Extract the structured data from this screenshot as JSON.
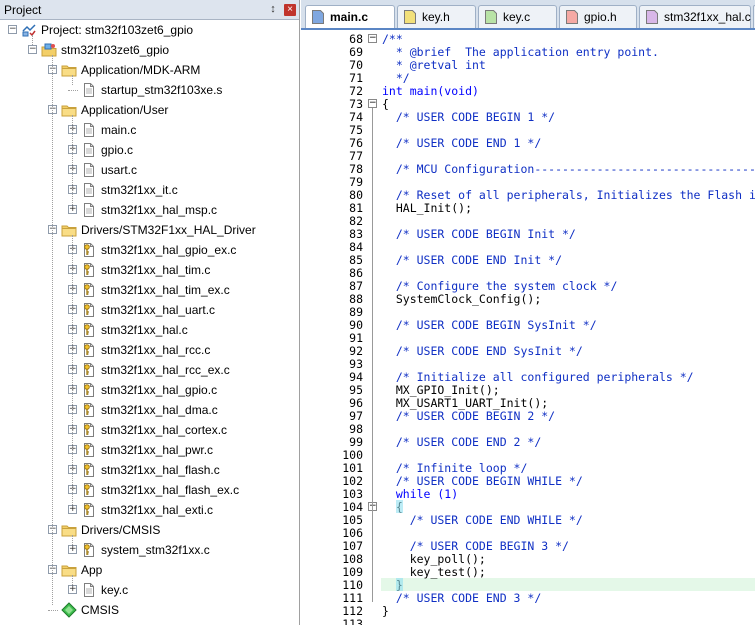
{
  "panel": {
    "title": "Project",
    "pin_glyph": "↕",
    "close_glyph": "×"
  },
  "tree": [
    {
      "label": "Project: stm32f103zet6_gpio",
      "level": 0,
      "icon": "project-icon",
      "expander": "−"
    },
    {
      "label": "stm32f103zet6_gpio",
      "level": 1,
      "icon": "target-icon",
      "expander": "−"
    },
    {
      "label": "Application/MDK-ARM",
      "level": 2,
      "icon": "folder-icon",
      "expander": "−"
    },
    {
      "label": "startup_stm32f103xe.s",
      "level": 3,
      "icon": "file-icon",
      "expander": ""
    },
    {
      "label": "Application/User",
      "level": 2,
      "icon": "folder-icon",
      "expander": "−"
    },
    {
      "label": "main.c",
      "level": 3,
      "icon": "file-icon",
      "expander": "+"
    },
    {
      "label": "gpio.c",
      "level": 3,
      "icon": "file-icon",
      "expander": "+"
    },
    {
      "label": "usart.c",
      "level": 3,
      "icon": "file-icon",
      "expander": "+"
    },
    {
      "label": "stm32f1xx_it.c",
      "level": 3,
      "icon": "file-icon",
      "expander": "+"
    },
    {
      "label": "stm32f1xx_hal_msp.c",
      "level": 3,
      "icon": "file-icon",
      "expander": "+"
    },
    {
      "label": "Drivers/STM32F1xx_HAL_Driver",
      "level": 2,
      "icon": "folder-icon",
      "expander": "−"
    },
    {
      "label": "stm32f1xx_hal_gpio_ex.c",
      "level": 3,
      "icon": "key-file-icon",
      "expander": "+"
    },
    {
      "label": "stm32f1xx_hal_tim.c",
      "level": 3,
      "icon": "key-file-icon",
      "expander": "+"
    },
    {
      "label": "stm32f1xx_hal_tim_ex.c",
      "level": 3,
      "icon": "key-file-icon",
      "expander": "+"
    },
    {
      "label": "stm32f1xx_hal_uart.c",
      "level": 3,
      "icon": "key-file-icon",
      "expander": "+"
    },
    {
      "label": "stm32f1xx_hal.c",
      "level": 3,
      "icon": "key-file-icon",
      "expander": "+"
    },
    {
      "label": "stm32f1xx_hal_rcc.c",
      "level": 3,
      "icon": "key-file-icon",
      "expander": "+"
    },
    {
      "label": "stm32f1xx_hal_rcc_ex.c",
      "level": 3,
      "icon": "key-file-icon",
      "expander": "+"
    },
    {
      "label": "stm32f1xx_hal_gpio.c",
      "level": 3,
      "icon": "key-file-icon",
      "expander": "+"
    },
    {
      "label": "stm32f1xx_hal_dma.c",
      "level": 3,
      "icon": "key-file-icon",
      "expander": "+"
    },
    {
      "label": "stm32f1xx_hal_cortex.c",
      "level": 3,
      "icon": "key-file-icon",
      "expander": "+"
    },
    {
      "label": "stm32f1xx_hal_pwr.c",
      "level": 3,
      "icon": "key-file-icon",
      "expander": "+"
    },
    {
      "label": "stm32f1xx_hal_flash.c",
      "level": 3,
      "icon": "key-file-icon",
      "expander": "+"
    },
    {
      "label": "stm32f1xx_hal_flash_ex.c",
      "level": 3,
      "icon": "key-file-icon",
      "expander": "+"
    },
    {
      "label": "stm32f1xx_hal_exti.c",
      "level": 3,
      "icon": "key-file-icon",
      "expander": "+"
    },
    {
      "label": "Drivers/CMSIS",
      "level": 2,
      "icon": "folder-icon",
      "expander": "−"
    },
    {
      "label": "system_stm32f1xx.c",
      "level": 3,
      "icon": "key-file-icon",
      "expander": "+"
    },
    {
      "label": "App",
      "level": 2,
      "icon": "folder-icon",
      "expander": "−"
    },
    {
      "label": "key.c",
      "level": 3,
      "icon": "file-icon",
      "expander": "+"
    },
    {
      "label": "CMSIS",
      "level": 2,
      "icon": "cmsis-icon",
      "expander": ""
    }
  ],
  "tabs": [
    {
      "label": "main.c",
      "active": true,
      "color": "#7fa7e0"
    },
    {
      "label": "key.h",
      "active": false,
      "color": "#f2e07a"
    },
    {
      "label": "key.c",
      "active": false,
      "color": "#b9e3a7"
    },
    {
      "label": "gpio.h",
      "active": false,
      "color": "#f5a9a4"
    },
    {
      "label": "stm32f1xx_hal.c",
      "active": false,
      "color": "#d8b7e8"
    },
    {
      "label": "",
      "active": false,
      "color": "#b9e3a7"
    }
  ],
  "code": [
    {
      "n": "68",
      "t": "/**",
      "c": "cmt",
      "fold": "−"
    },
    {
      "n": "69",
      "t": "  * @brief  The application entry point.",
      "c": "cmt"
    },
    {
      "n": "70",
      "t": "  * @retval int",
      "c": "cmt"
    },
    {
      "n": "71",
      "t": "  */",
      "c": "cmt"
    },
    {
      "n": "72",
      "t": "int main(void)",
      "c": "kwline"
    },
    {
      "n": "73",
      "t": "{",
      "c": "tx",
      "fold": "−"
    },
    {
      "n": "74",
      "t": "  /* USER CODE BEGIN 1 */",
      "c": "cmt2"
    },
    {
      "n": "75",
      "t": "",
      "c": "tx"
    },
    {
      "n": "76",
      "t": "  /* USER CODE END 1 */",
      "c": "cmt2"
    },
    {
      "n": "77",
      "t": "",
      "c": "tx"
    },
    {
      "n": "78",
      "t": "  /* MCU Configuration--------------------------------------------------------*/",
      "c": "cmt2"
    },
    {
      "n": "79",
      "t": "",
      "c": "tx"
    },
    {
      "n": "80",
      "t": "  /* Reset of all peripherals, Initializes the Flash interface and the Systick. */",
      "c": "cmt2"
    },
    {
      "n": "81",
      "t": "  HAL_Init();",
      "c": "tx"
    },
    {
      "n": "82",
      "t": "",
      "c": "tx"
    },
    {
      "n": "83",
      "t": "  /* USER CODE BEGIN Init */",
      "c": "cmt2"
    },
    {
      "n": "84",
      "t": "",
      "c": "tx"
    },
    {
      "n": "85",
      "t": "  /* USER CODE END Init */",
      "c": "cmt2"
    },
    {
      "n": "86",
      "t": "",
      "c": "tx"
    },
    {
      "n": "87",
      "t": "  /* Configure the system clock */",
      "c": "cmt2"
    },
    {
      "n": "88",
      "t": "  SystemClock_Config();",
      "c": "tx"
    },
    {
      "n": "89",
      "t": "",
      "c": "tx"
    },
    {
      "n": "90",
      "t": "  /* USER CODE BEGIN SysInit */",
      "c": "cmt2"
    },
    {
      "n": "91",
      "t": "",
      "c": "tx"
    },
    {
      "n": "92",
      "t": "  /* USER CODE END SysInit */",
      "c": "cmt2"
    },
    {
      "n": "93",
      "t": "",
      "c": "tx"
    },
    {
      "n": "94",
      "t": "  /* Initialize all configured peripherals */",
      "c": "cmt2"
    },
    {
      "n": "95",
      "t": "  MX_GPIO_Init();",
      "c": "tx"
    },
    {
      "n": "96",
      "t": "  MX_USART1_UART_Init();",
      "c": "tx"
    },
    {
      "n": "97",
      "t": "  /* USER CODE BEGIN 2 */",
      "c": "cmt2"
    },
    {
      "n": "98",
      "t": "",
      "c": "tx"
    },
    {
      "n": "99",
      "t": "  /* USER CODE END 2 */",
      "c": "cmt2"
    },
    {
      "n": "100",
      "t": "",
      "c": "tx"
    },
    {
      "n": "101",
      "t": "  /* Infinite loop */",
      "c": "cmt2"
    },
    {
      "n": "102",
      "t": "  /* USER CODE BEGIN WHILE */",
      "c": "cmt2"
    },
    {
      "n": "103",
      "t": "  while (1)",
      "c": "whileline"
    },
    {
      "n": "104",
      "t": "  {",
      "c": "bracebox",
      "fold": "−"
    },
    {
      "n": "105",
      "t": "    /* USER CODE END WHILE */",
      "c": "cmt2"
    },
    {
      "n": "106",
      "t": "",
      "c": "tx"
    },
    {
      "n": "107",
      "t": "    /* USER CODE BEGIN 3 */",
      "c": "cmt2"
    },
    {
      "n": "108",
      "t": "    key_poll();",
      "c": "tx"
    },
    {
      "n": "109",
      "t": "    key_test();",
      "c": "tx"
    },
    {
      "n": "110",
      "t": "  }",
      "c": "bracebox",
      "hl": true
    },
    {
      "n": "111",
      "t": "  /* USER CODE END 3 */",
      "c": "cmt2"
    },
    {
      "n": "112",
      "t": "}",
      "c": "tx"
    },
    {
      "n": "113",
      "t": "",
      "c": "tx"
    }
  ]
}
